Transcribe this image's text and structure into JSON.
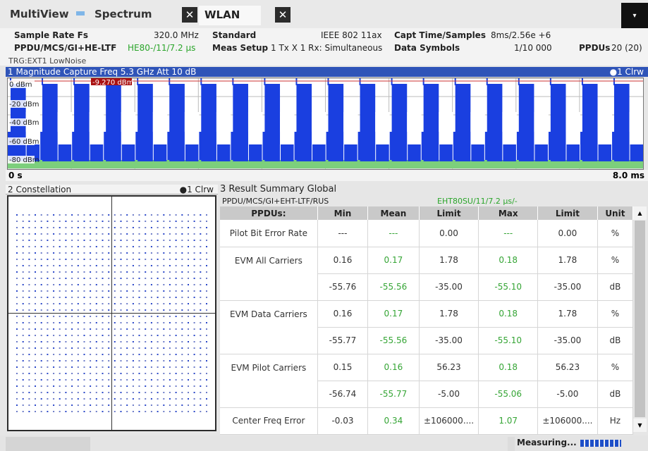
{
  "tabs": [
    {
      "label": "MultiView"
    },
    {
      "label": "Spectrum",
      "close": "✕"
    },
    {
      "label": "WLAN",
      "close": "✕"
    }
  ],
  "menu_glyph": "▾",
  "header": {
    "sample_rate_label": "Sample Rate Fs",
    "sample_rate_value": "320.0 MHz",
    "standard_label": "Standard",
    "standard_value": "IEEE 802 11ax",
    "capt_label": "Capt Time/Samples",
    "capt_value": "8ms/2.56e +6",
    "ppdu_label": "PPDU/MCS/GI+HE-LTF",
    "ppdu_value": "HE80-/11/7.2 μs",
    "meas_setup_label": "Meas Setup",
    "meas_setup_value": "1 Tx X 1 Rx: Simultaneous",
    "data_symbols_label": "Data Symbols",
    "data_symbols_value": "1/10 000",
    "ppdus_label": "PPDUs",
    "ppdus_value": "20 (20)",
    "trigger": "TRG:EXT1 LowNoise"
  },
  "magnitude": {
    "title": "1 Magnitude Capture  Freq 5.3 GHz Att 10 dB",
    "trace": "●1 Clrw",
    "x_start": "0 s",
    "x_stop": "8.0 ms",
    "marker_label": "-9.270 dBm",
    "y_labels": [
      "0 dBm",
      "-20 dBm",
      "-40 dBm",
      "-60 dBm",
      "-80 dBm"
    ],
    "trace_color": "#1a3fe0",
    "noise_color": "#7ccf7c"
  },
  "constellation": {
    "title": "2 Constellation",
    "trace": "●1 Clrw"
  },
  "result_summary": {
    "title": "3 Result Summary Global",
    "subtitle": "PPDU/MCS/GI+EHT-LTF/RUS",
    "subtitle_value": "EHT80SU/11/7.2 μs/-",
    "columns": [
      "PPDUs:",
      "Min",
      "Mean",
      "Limit",
      "Max",
      "Limit",
      "Unit"
    ],
    "rows": [
      {
        "name": "Pilot Bit Error Rate",
        "min": "---",
        "mean": "---",
        "limit1": "0.00",
        "max": "---",
        "limit2": "0.00",
        "unit": "%"
      },
      {
        "name": "EVM All Carriers",
        "min": "0.16",
        "mean": "0.17",
        "limit1": "1.78",
        "max": "0.18",
        "limit2": "1.78",
        "unit": "%"
      },
      {
        "name": "",
        "min": "-55.76",
        "mean": "-55.56",
        "limit1": "-35.00",
        "max": "-55.10",
        "limit2": "-35.00",
        "unit": "dB"
      },
      {
        "name": "EVM Data Carriers",
        "min": "0.16",
        "mean": "0.17",
        "limit1": "1.78",
        "max": "0.18",
        "limit2": "1.78",
        "unit": "%"
      },
      {
        "name": "",
        "min": "-55.77",
        "mean": "-55.56",
        "limit1": "-35.00",
        "max": "-55.10",
        "limit2": "-35.00",
        "unit": "dB"
      },
      {
        "name": "EVM Pilot Carriers",
        "min": "0.15",
        "mean": "0.16",
        "limit1": "56.23",
        "max": "0.18",
        "limit2": "56.23",
        "unit": "%"
      },
      {
        "name": "",
        "min": "-56.74",
        "mean": "-55.77",
        "limit1": "-5.00",
        "max": "-55.06",
        "limit2": "-5.00",
        "unit": "dB"
      },
      {
        "name": "Center Freq Error",
        "min": "-0.03",
        "mean": "0.34",
        "limit1": "±106000....",
        "max": "1.07",
        "limit2": "±106000....",
        "unit": "Hz"
      }
    ],
    "scroll_up": "▲",
    "scroll_down": "▼"
  },
  "status": {
    "measuring": "Measuring..."
  }
}
